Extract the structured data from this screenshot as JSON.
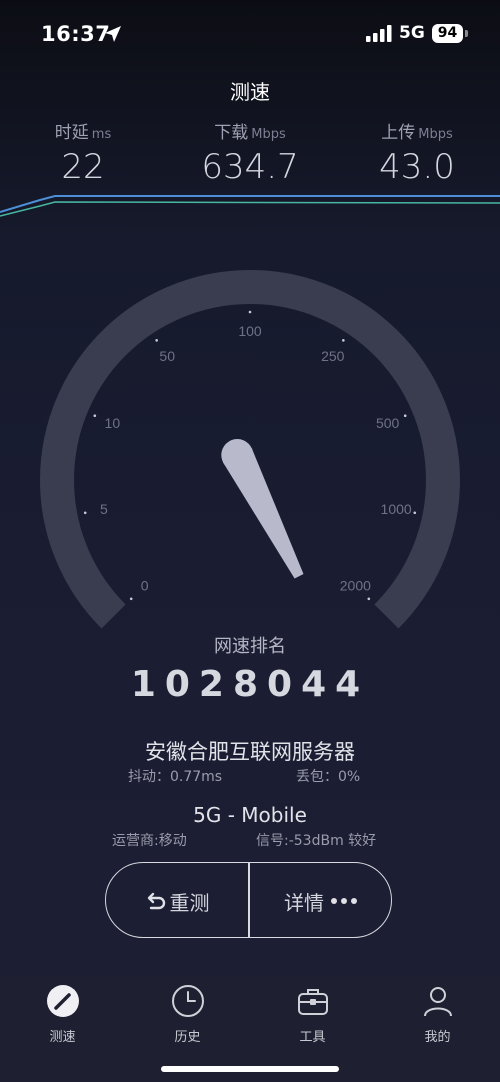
{
  "status_bar": {
    "time": "16:37",
    "network": "5G",
    "battery": "94",
    "icons": [
      "location-arrow-icon",
      "signal-bars-icon",
      "battery-icon"
    ]
  },
  "page": {
    "title": "测速"
  },
  "metrics": {
    "latency": {
      "label": "时延",
      "unit": "ms",
      "value": "22"
    },
    "download": {
      "label": "下载",
      "unit": "Mbps",
      "value": "634.7"
    },
    "upload": {
      "label": "上传",
      "unit": "Mbps",
      "value": "43.0"
    }
  },
  "gauge": {
    "ticks": [
      "0",
      "5",
      "10",
      "50",
      "100",
      "250",
      "500",
      "1000",
      "2000"
    ],
    "needle_tick_fraction": 0.4
  },
  "rank": {
    "label": "网速排名",
    "value": "1028044"
  },
  "server": {
    "name": "安徽合肥互联网服务器",
    "jitter": "抖动：0.77ms",
    "loss": "丢包：0%"
  },
  "network": {
    "name": "5G - Mobile",
    "carrier": "运营商:移动",
    "signal": "信号:-53dBm 较好"
  },
  "buttons": {
    "retest": "重测",
    "detail": "详情"
  },
  "tabs": [
    {
      "label": "测速",
      "icon": "speedometer-icon"
    },
    {
      "label": "历史",
      "icon": "clock-icon"
    },
    {
      "label": "工具",
      "icon": "toolbox-icon"
    },
    {
      "label": "我的",
      "icon": "person-icon"
    }
  ],
  "colors": {
    "background": "#1b1d33",
    "gauge_track": "#3a3c50",
    "needle": "#b8bacb",
    "wave_blue": "#4d8fd6",
    "wave_green": "#47b7a0",
    "tab_bar": "#1e2031"
  }
}
